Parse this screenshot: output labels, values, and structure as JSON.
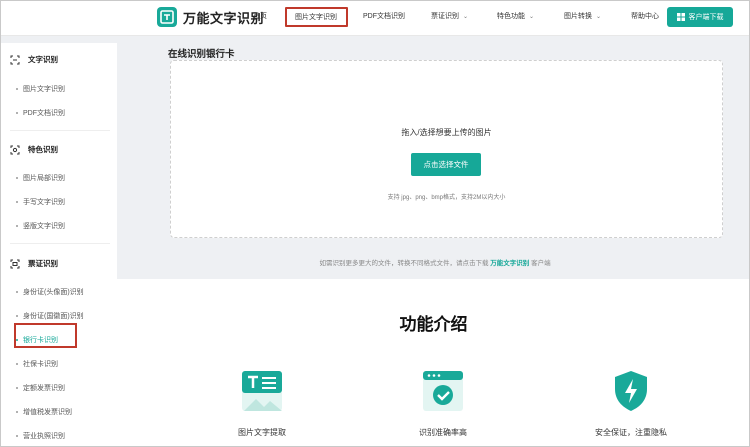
{
  "header": {
    "app_title": "万能文字识别",
    "nav": [
      {
        "label": "首页",
        "dropdown": false
      },
      {
        "label": "图片文字识别",
        "dropdown": false,
        "active": true
      },
      {
        "label": "PDF文档识别",
        "dropdown": false
      },
      {
        "label": "票证识别",
        "dropdown": true
      },
      {
        "label": "特色功能",
        "dropdown": true
      },
      {
        "label": "图片转换",
        "dropdown": true
      },
      {
        "label": "帮助中心",
        "dropdown": false
      }
    ],
    "download_label": "客户端下载"
  },
  "sidebar": {
    "sections": [
      {
        "title": "文字识别",
        "icon": "scan-text-icon",
        "items": [
          "图片文字识别",
          "PDF文档识别"
        ]
      },
      {
        "title": "特色识别",
        "icon": "scan-special-icon",
        "items": [
          "图片局部识别",
          "手写文字识别",
          "竖版文字识别"
        ]
      },
      {
        "title": "票证识别",
        "icon": "scan-ticket-icon",
        "items": [
          "身份证(头像面)识别",
          "身份证(国徽面)识别",
          "银行卡识别",
          "社保卡识别",
          "定额发票识别",
          "增值税发票识别",
          "营业执照识别"
        ]
      }
    ],
    "active_item": "银行卡识别"
  },
  "main": {
    "title": "在线识别银行卡",
    "upload_hint": "拖入/选择想要上传的图片",
    "upload_button": "点击选择文件",
    "upload_formats": "支持 jpg、png、bmp格式，支持2M以内大小",
    "client_note_prefix": "如需识别更多更大的文件，转换不同格式文件，请点击下载",
    "client_note_brand": "万能文字识别",
    "client_note_suffix": "客户端"
  },
  "features": {
    "title": "功能介绍",
    "items": [
      {
        "label": "图片文字提取",
        "icon": "image-text-icon"
      },
      {
        "label": "识别准确率高",
        "icon": "check-screen-icon"
      },
      {
        "label": "安全保证，注重隐私",
        "icon": "shield-bolt-icon"
      }
    ]
  },
  "colors": {
    "accent": "#16a898",
    "highlight": "#c0392b"
  }
}
